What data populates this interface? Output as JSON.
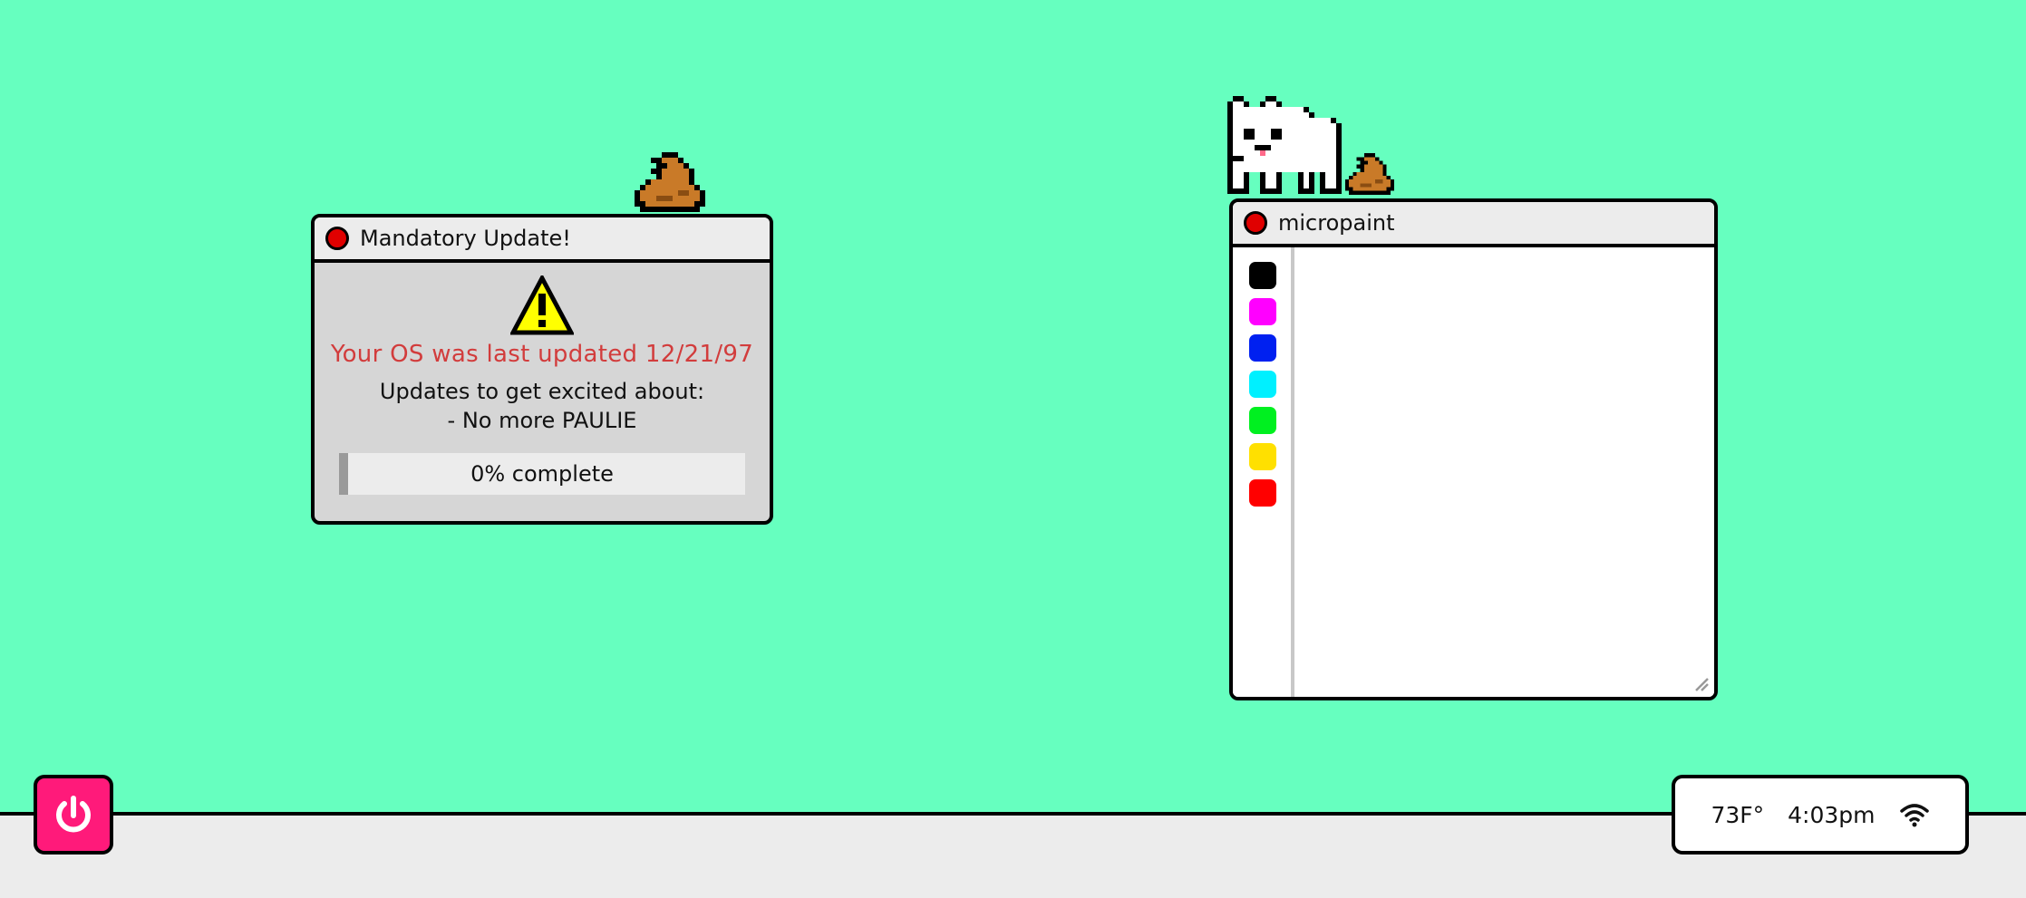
{
  "update_window": {
    "title": "Mandatory Update!",
    "warning": "Your OS was last updated 12/21/97",
    "heading": "Updates to get excited about:",
    "items": [
      "- No more PAULIE"
    ],
    "progress_percent": 0,
    "progress_label": "0% complete",
    "icon": "warning-triangle-icon"
  },
  "paint_window": {
    "title": "micropaint",
    "palette": [
      "#000000",
      "#ff00ff",
      "#0020f0",
      "#00f0ff",
      "#00f020",
      "#ffe000",
      "#ff0000"
    ]
  },
  "taskbar": {
    "power_icon": "power-icon",
    "temperature": "73F°",
    "time": "4:03pm",
    "wifi_icon": "wifi-icon"
  },
  "colors": {
    "desktop": "#66ffbf",
    "power_button": "#ff1a7a",
    "warning_text": "#d23c3c",
    "close_button": "#e00000"
  }
}
